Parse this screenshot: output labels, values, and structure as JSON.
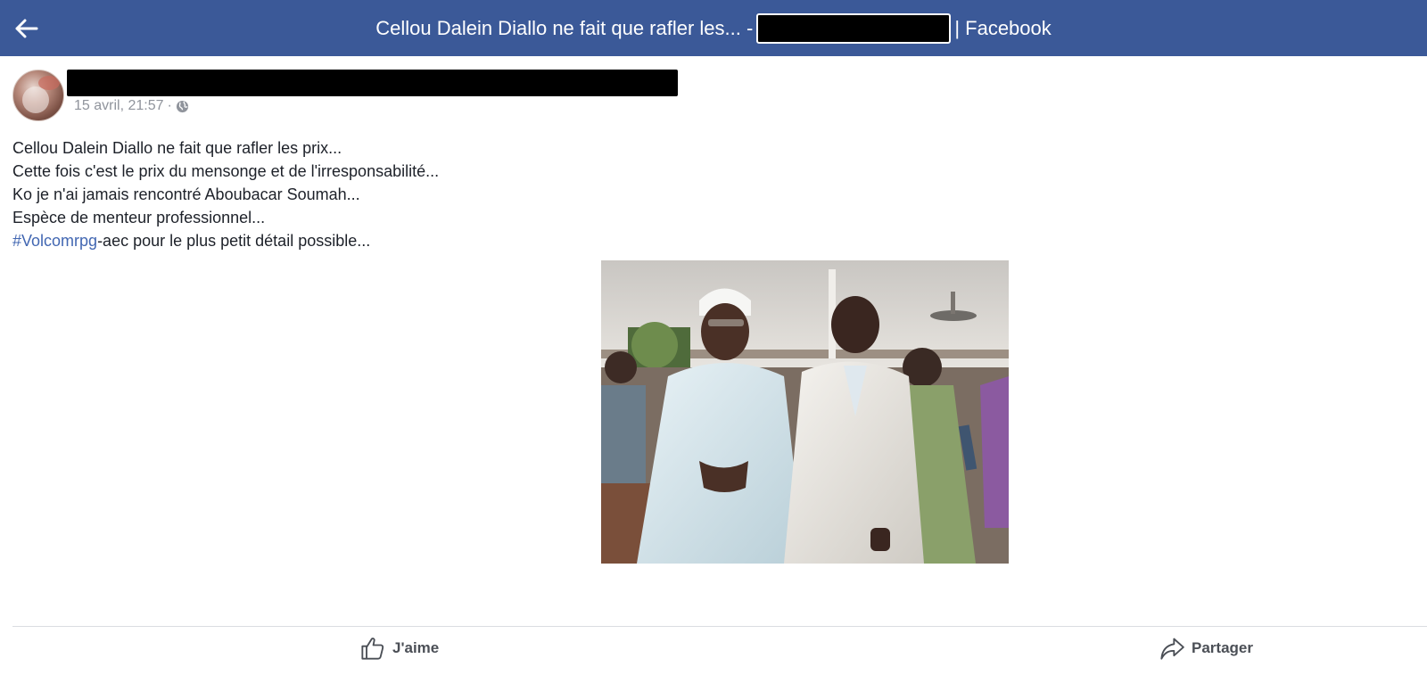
{
  "header": {
    "back_icon": "arrow-left-icon",
    "title_prefix": "Cellou Dalein Diallo ne fait que rafler les... -",
    "title_suffix": "| Facebook"
  },
  "post": {
    "timestamp": "15 avril, 21:57",
    "separator": "·",
    "privacy_icon": "globe-icon",
    "lines": [
      "Cellou Dalein Diallo ne fait que rafler les prix...",
      "Cette fois c'est le prix du mensonge et de l'irresponsabilité...",
      "Ko je n'ai jamais rencontré Aboubacar Soumah...",
      "Espèce de menteur professionnel..."
    ],
    "hashtag": "#Volcomrpg",
    "hashtag_rest": "-aec pour le plus petit détail possible..."
  },
  "actions": {
    "like_label": "J'aime",
    "like_icon": "thumbs-up-icon",
    "share_label": "Partager",
    "share_icon": "share-arrow-icon"
  },
  "colors": {
    "header_bg": "#3b5998",
    "hashtag": "#4267b2",
    "meta_text": "#90949c"
  }
}
